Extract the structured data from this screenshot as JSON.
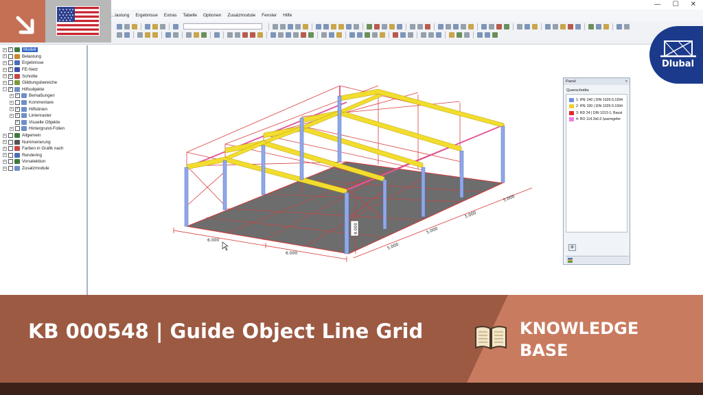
{
  "menu": [
    "...lastung",
    "Ergebnisse",
    "Extras",
    "Tabelle",
    "Optionen",
    "Zusatzmodule",
    "Fenster",
    "Hilfe"
  ],
  "window_controls": [
    "—",
    "☐",
    "✕"
  ],
  "navigator": {
    "items": [
      {
        "label": "Modell",
        "level": 0,
        "checked": true,
        "expander": "+",
        "icon_color": "#3d7a3d",
        "selected": true
      },
      {
        "label": "Belastung",
        "level": 0,
        "checked": false,
        "expander": "+",
        "icon_color": "#c9882a"
      },
      {
        "label": "Ergebnisse",
        "level": 0,
        "checked": false,
        "expander": "+",
        "icon_color": "#4a6fb6"
      },
      {
        "label": "FE-Netz",
        "level": 0,
        "checked": true,
        "expander": "+",
        "icon_color": "#3d4fa8"
      },
      {
        "label": "Schnitte",
        "level": 0,
        "checked": true,
        "expander": "+",
        "icon_color": "#c84545"
      },
      {
        "label": "Glättungsbereiche",
        "level": 0,
        "checked": false,
        "expander": "+",
        "icon_color": "#7b9a3a"
      },
      {
        "label": "Hilfsobjekte",
        "level": 0,
        "checked": true,
        "expander": "−",
        "icon_color": "#6e8fc7"
      },
      {
        "label": "Bemaßungen",
        "level": 1,
        "checked": true,
        "expander": "+",
        "icon_color": "#6e8fc7"
      },
      {
        "label": "Kommentare",
        "level": 1,
        "checked": false,
        "expander": "+",
        "icon_color": "#6e8fc7"
      },
      {
        "label": "Hilfslinien",
        "level": 1,
        "checked": true,
        "expander": "+",
        "icon_color": "#6e8fc7"
      },
      {
        "label": "Linienraster",
        "level": 1,
        "checked": true,
        "expander": "+",
        "icon_color": "#6e8fc7"
      },
      {
        "label": "Visuelle Objekte",
        "level": 1,
        "checked": true,
        "expander": "",
        "icon_color": "#6e8fc7"
      },
      {
        "label": "Hintergrund-Folien",
        "level": 1,
        "checked": false,
        "expander": "+",
        "icon_color": "#6e8fc7"
      },
      {
        "label": "Allgemein",
        "level": 0,
        "checked": false,
        "expander": "+",
        "icon_color": "#3d7a3d"
      },
      {
        "label": "Nummerierung",
        "level": 0,
        "checked": false,
        "expander": "+",
        "icon_color": "#555555"
      },
      {
        "label": "Farben in Grafik nach",
        "level": 0,
        "checked": false,
        "expander": "+",
        "icon_color": "#c84545"
      },
      {
        "label": "Rendering",
        "level": 0,
        "checked": false,
        "expander": "+",
        "icon_color": "#4a6fb6"
      },
      {
        "label": "Vorselektion",
        "level": 0,
        "checked": false,
        "expander": "+",
        "icon_color": "#3d7a3d"
      },
      {
        "label": "Zusatzmodule",
        "level": 0,
        "checked": false,
        "expander": "+",
        "icon_color": "#6e8fc7"
      }
    ]
  },
  "model_view": {
    "dimensions": {
      "front_left": "6.000",
      "front_right": "6.000",
      "height": "4.000",
      "side": [
        "5.000",
        "5.000",
        "5.000",
        "5.000"
      ]
    },
    "colors": {
      "columns": "#8fa8e8",
      "rafters": "#f2dd2e",
      "bracing": "#e05a9a",
      "grid": "#d93a3a",
      "floor": "#6d6d6d"
    }
  },
  "panel": {
    "title": "Panel",
    "close": "×",
    "section_title": "Querschnitte",
    "legend": [
      {
        "color": "#6f8fe0",
        "label": "1: IPE 240 | DIN 1025-5:1994"
      },
      {
        "color": "#f0d22a",
        "label": "2: IPE 330 | DIN 1025-5:1994"
      },
      {
        "color": "#e32a2a",
        "label": "3: RD 24 | DIN 1013-1; Baust"
      },
      {
        "color": "#f07ce0",
        "label": "4: RO 114.3x6.0 (warmgefer"
      }
    ],
    "button_icon": "panel-settings"
  },
  "logo": {
    "text": "Dlubal"
  },
  "banner": {
    "title": "KB 000548 | Guide Object Line Grid",
    "kb_line1": "KNOWLEDGE",
    "kb_line2": "BASE"
  },
  "badge": {
    "flag": "us-flag",
    "arrow": "arrow-down-right"
  }
}
